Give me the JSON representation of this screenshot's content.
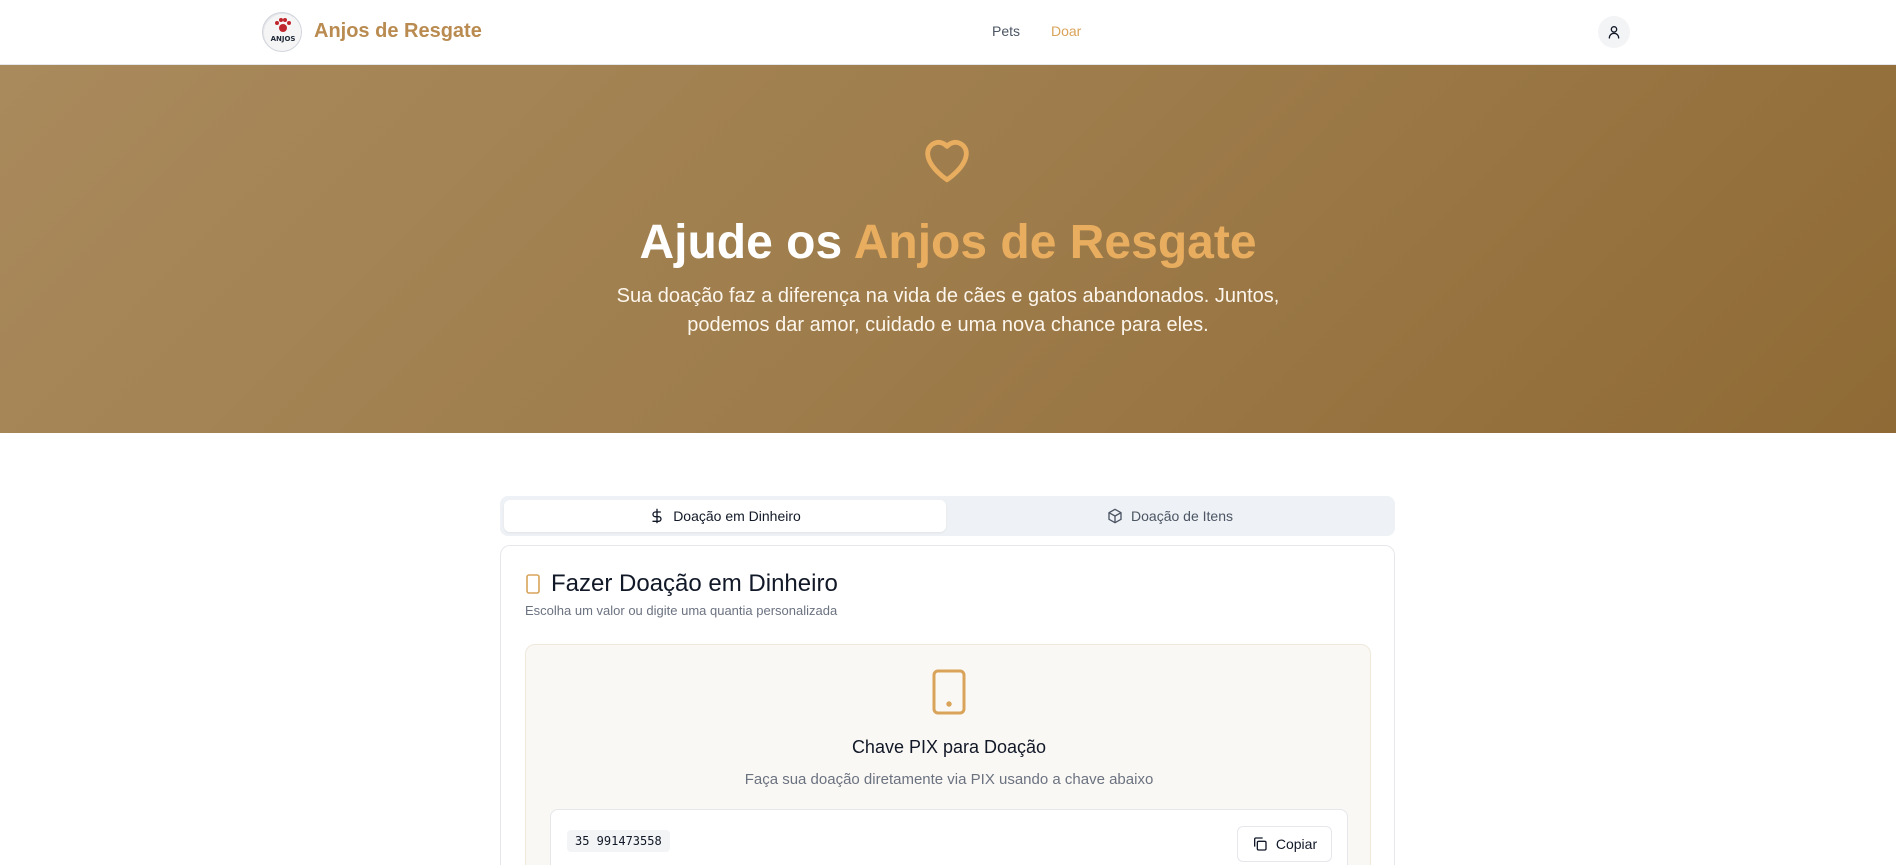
{
  "header": {
    "brand": "Anjos de Resgate",
    "logo_text": "ANJOS",
    "nav": [
      {
        "label": "Pets"
      },
      {
        "label": "Doar",
        "active": true
      }
    ],
    "user_icon": "user-icon"
  },
  "hero": {
    "icon": "heart-icon",
    "title_prefix": "Ajude os ",
    "title_accent": "Anjos de Resgate",
    "subtitle": "Sua doação faz a diferença na vida de cães e gatos abandonados. Juntos, podemos dar amor, cuidado e uma nova chance para eles."
  },
  "tabs": [
    {
      "label": "Doação em Dinheiro",
      "icon": "dollar-icon",
      "active": true
    },
    {
      "label": "Doação de Itens",
      "icon": "package-icon",
      "active": false
    }
  ],
  "card": {
    "title": "Fazer Doação em Dinheiro",
    "title_icon": "smartphone-icon",
    "description": "Escolha um valor ou digite uma quantia personalizada"
  },
  "pix": {
    "icon": "smartphone-icon",
    "title": "Chave PIX para Doação",
    "description": "Faça sua doação diretamente via PIX usando a chave abaixo",
    "key": "35 991473558",
    "copy_label": "Copiar"
  },
  "colors": {
    "brand": "#b98b50",
    "accent": "#d9a35a",
    "hero_start": "#a98a5c",
    "hero_end": "#8f6a35"
  }
}
